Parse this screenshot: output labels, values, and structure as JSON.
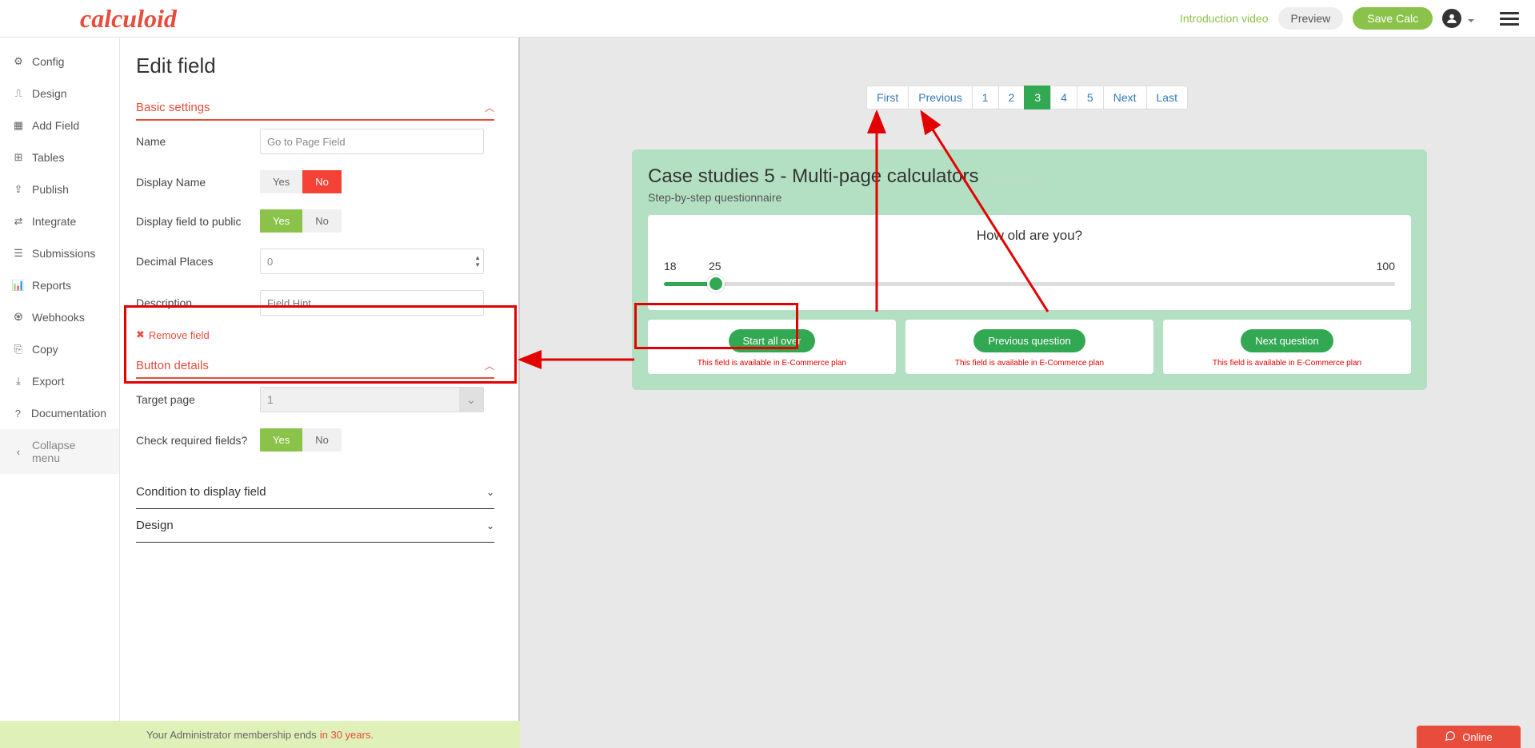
{
  "header": {
    "logo": "calculoid",
    "intro_video": "Introduction video",
    "preview": "Preview",
    "save": "Save Calc"
  },
  "sidebar": {
    "items": [
      {
        "label": "Config",
        "icon": "⚙"
      },
      {
        "label": "Design",
        "icon": "⎍"
      },
      {
        "label": "Add Field",
        "icon": "▦"
      },
      {
        "label": "Tables",
        "icon": "⊞"
      },
      {
        "label": "Publish",
        "icon": "⇪"
      },
      {
        "label": "Integrate",
        "icon": "⇄"
      },
      {
        "label": "Submissions",
        "icon": "☰"
      },
      {
        "label": "Reports",
        "icon": "📊"
      },
      {
        "label": "Webhooks",
        "icon": "♼"
      },
      {
        "label": "Copy",
        "icon": "⎘"
      },
      {
        "label": "Export",
        "icon": "⤓"
      },
      {
        "label": "Documentation",
        "icon": "?"
      },
      {
        "label": "Collapse menu",
        "icon": "‹"
      }
    ]
  },
  "edit": {
    "title": "Edit field",
    "basic_settings": "Basic settings",
    "name_label": "Name",
    "name_value": "Go to Page Field",
    "display_name_label": "Display Name",
    "yes": "Yes",
    "no": "No",
    "display_public_label": "Display field to public",
    "decimal_label": "Decimal Places",
    "decimal_value": "0",
    "description_label": "Description",
    "description_placeholder": "Field Hint",
    "remove_field": "Remove field",
    "button_details": "Button details",
    "target_page_label": "Target page",
    "target_page_value": "1",
    "check_required_label": "Check required fields?",
    "condition_section": "Condition to display field",
    "design_section": "Design"
  },
  "pagination": {
    "first": "First",
    "previous": "Previous",
    "pages": [
      "1",
      "2",
      "3",
      "4",
      "5"
    ],
    "active_index": 2,
    "next": "Next",
    "last": "Last"
  },
  "calc": {
    "title": "Case studies 5 - Multi-page calculators",
    "subtitle": "Step-by-step questionnaire",
    "question": "How old are you?",
    "slider_min": "18",
    "slider_mid": "25",
    "slider_max": "100",
    "buttons": [
      {
        "label": "Start all over"
      },
      {
        "label": "Previous question"
      },
      {
        "label": "Next question"
      }
    ],
    "ecom_note": "This field is available in E-Commerce plan"
  },
  "footer": {
    "text": "Your Administrator membership ends ",
    "highlight": "in 30 years."
  },
  "online_widget": "Online"
}
